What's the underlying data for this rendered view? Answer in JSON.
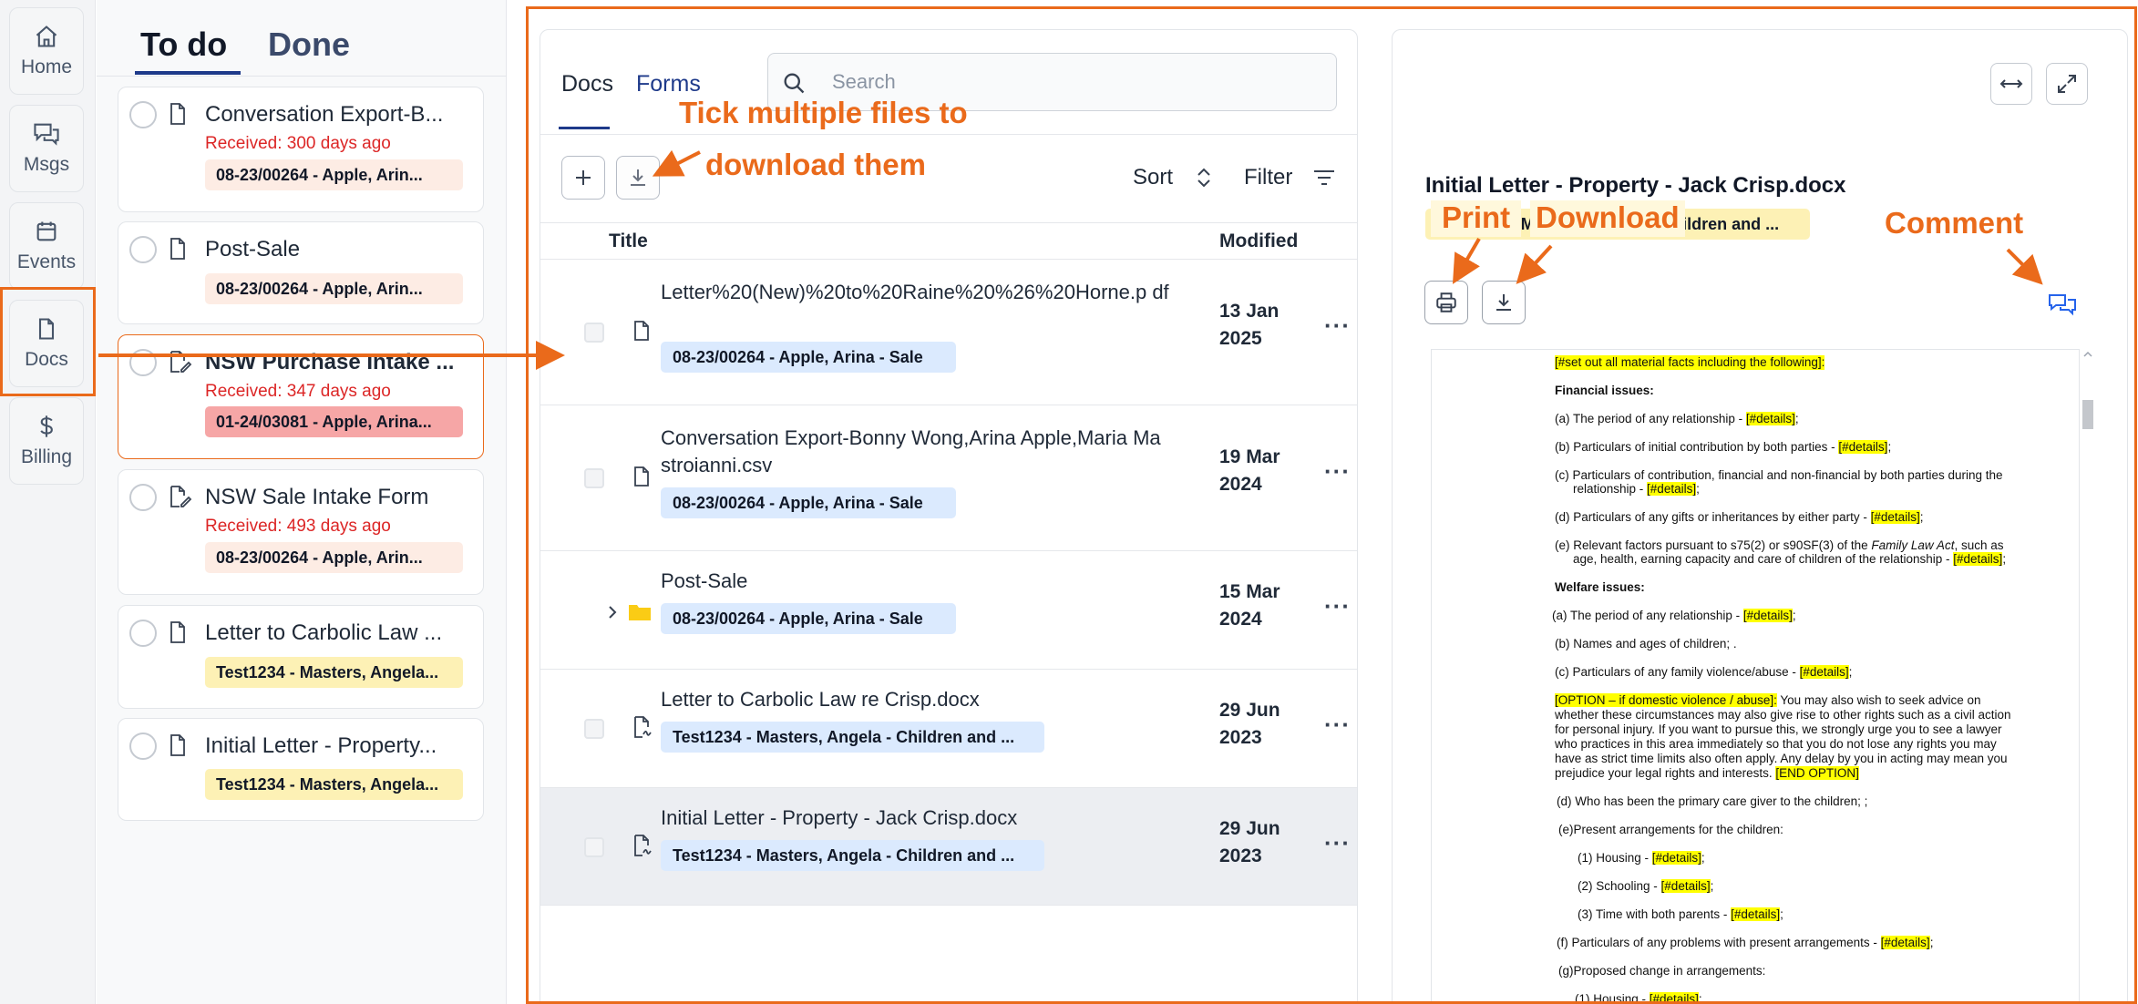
{
  "nav": {
    "items": [
      {
        "label": "Home",
        "icon": "home-icon"
      },
      {
        "label": "Msgs",
        "icon": "chat-icon"
      },
      {
        "label": "Events",
        "icon": "calendar-icon"
      },
      {
        "label": "Docs",
        "icon": "document-icon"
      },
      {
        "label": "Billing",
        "icon": "dollar-icon"
      }
    ]
  },
  "todo_panel": {
    "tabs": [
      "To do",
      "Done"
    ],
    "cards": [
      {
        "title": "Conversation Export-B...",
        "received": "Received: 300 days ago",
        "tag": "08-23/00264 - Apple, Arin..."
      },
      {
        "title": "Post-Sale",
        "received": "",
        "tag": "08-23/00264 - Apple, Arin..."
      },
      {
        "title": "NSW Purchase Intake ...",
        "received": "Received: 347 days ago",
        "tag": "01-24/03081 - Apple, Arina..."
      },
      {
        "title": "NSW Sale Intake Form",
        "received": "Received: 493 days ago",
        "tag": "08-23/00264 - Apple, Arin..."
      },
      {
        "title": "Letter to Carbolic Law ...",
        "received": "",
        "tag": "Test1234 - Masters, Angela..."
      },
      {
        "title": "Initial Letter - Property...",
        "received": "",
        "tag": "Test1234 - Masters, Angela..."
      }
    ]
  },
  "docs_panel": {
    "tabs": [
      "Docs",
      "Forms"
    ],
    "search_placeholder": "Search",
    "sort_label": "Sort",
    "filter_label": "Filter",
    "columns": {
      "title": "Title",
      "modified": "Modified"
    },
    "rows": [
      {
        "title": "Letter%20(New)%20to%20Raine%20%26%20Horne.p df",
        "tag": "08-23/00264 - Apple, Arina - Sale",
        "date_line1": "13 Jan",
        "date_line2": "2025",
        "kind": "file"
      },
      {
        "title": "Conversation Export-Bonny Wong,Arina Apple,Maria Ma stroianni.csv",
        "tag": "08-23/00264 - Apple, Arina - Sale",
        "date_line1": "19 Mar",
        "date_line2": "2024",
        "kind": "file"
      },
      {
        "title": "Post-Sale",
        "tag": "08-23/00264 - Apple, Arina - Sale",
        "date_line1": "15 Mar",
        "date_line2": "2024",
        "kind": "folder"
      },
      {
        "title": "Letter to Carbolic Law re Crisp.docx",
        "tag": "Test1234 - Masters, Angela - Children and ...",
        "date_line1": "29 Jun",
        "date_line2": "2023",
        "kind": "signed-file"
      },
      {
        "title": "Initial Letter - Property - Jack Crisp.docx",
        "tag": "Test1234 - Masters, Angela - Children and ...",
        "date_line1": "29 Jun",
        "date_line2": "2023",
        "kind": "signed-file",
        "selected": true
      }
    ]
  },
  "preview": {
    "title": "Initial Letter - Property - Jack Crisp.docx",
    "tag": "Test1234 - Masters, Angela - Children and ...",
    "document_lines": [
      {
        "text": "[#set out all material facts including the following]:",
        "highlight": true
      },
      {
        "text": "Financial issues:",
        "bold": true
      },
      {
        "pre": "(a) The period of any relationship - ",
        "hl": "[#details]",
        "post": ";"
      },
      {
        "pre": "(b) Particulars of initial contribution by both parties - ",
        "hl": "[#details]",
        "post": ";"
      },
      {
        "pre": "(c) Particulars of contribution, financial and non-financial by both parties during the",
        "hl": "",
        "post": ""
      },
      {
        "pre": "relationship - ",
        "hl": "[#details]",
        "post": ";"
      },
      {
        "pre": "(d) Particulars of any gifts or inheritances by either party - ",
        "hl": "[#details]",
        "post": ";"
      },
      {
        "pre": "(e) Relevant factors pursuant to s75(2) or s90SF(3) of the ",
        "it": "Family Law Act",
        "post2": ", such as"
      },
      {
        "pre": "age, health, earning capacity and care of children of the relationship - ",
        "hl": "[#details]",
        "post": ";"
      },
      {
        "text": "Welfare issues:",
        "bold": true
      },
      {
        "pre": "(a) The period of any relationship - ",
        "hl": "[#details]",
        "post": ";"
      },
      {
        "pre": "(b) Names and ages of children; .",
        "hl": "",
        "post": ""
      },
      {
        "pre": "(c) Particulars of any family violence/abuse - ",
        "hl": "[#details]",
        "post": ";"
      },
      {
        "hlfirst": "[OPTION – if domestic violence / abuse]:",
        "post": "  You may also wish to seek advice on"
      },
      {
        "pre": "whether these circumstances may also give rise to other rights such as a civil action",
        "hl": "",
        "post": ""
      },
      {
        "pre": "for personal injury.  If you want to pursue this, we strongly urge you to see a lawyer",
        "hl": "",
        "post": ""
      },
      {
        "pre": "who practices in this area immediately so that you do not lose any rights you may",
        "hl": "",
        "post": ""
      },
      {
        "pre": "have as strict time limits also often apply.  Any delay by you in acting may mean you",
        "hl": "",
        "post": ""
      },
      {
        "pre": "prejudice your legal rights and interests. ",
        "hl": "[END OPTION]",
        "post": ""
      },
      {
        "pre": "(d) Who has been the primary care giver to the children; ;",
        "hl": "",
        "post": ""
      },
      {
        "pre": "(e)Present arrangements for the children:",
        "hl": "",
        "post": ""
      },
      {
        "pre": "(1) Housing - ",
        "hl": "[#details]",
        "post": ";"
      },
      {
        "pre": "(2) Schooling - ",
        "hl": "[#details]",
        "post": ";"
      },
      {
        "pre": "(3) Time with both parents - ",
        "hl": "[#details]",
        "post": ";"
      },
      {
        "pre": "(f) Particulars of any problems with present arrangements - ",
        "hl": "[#details]",
        "post": ";"
      },
      {
        "pre": "(g)Proposed change in arrangements:",
        "hl": "",
        "post": ""
      },
      {
        "pre": "(1) Housing - ",
        "hl": "[#details]",
        "post": ";"
      }
    ]
  },
  "annotations": {
    "tick_line1": "Tick multiple files to",
    "tick_line2": "download them",
    "print": "Print",
    "download": "Download",
    "comment": "Comment"
  },
  "colors": {
    "accent": "#ea6a1b",
    "tab_active": "#1e3a8a",
    "tag_blue": "#dbeafe",
    "tag_yellow": "#fdf1b5",
    "tag_peach": "#fdece4",
    "tag_red": "#f6a6a6"
  }
}
